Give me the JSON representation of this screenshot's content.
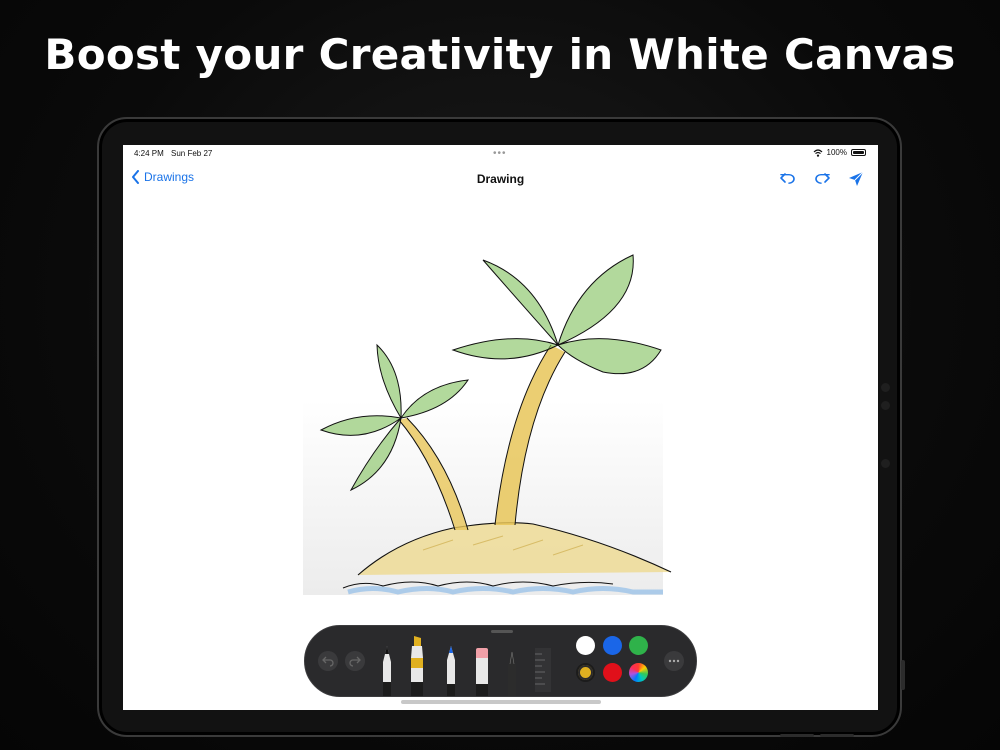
{
  "headline": "Boost your Creativity in White Canvas",
  "status_bar": {
    "time": "4:24 PM",
    "date": "Sun Feb 27",
    "battery": "100%"
  },
  "nav": {
    "back_label": "Drawings",
    "title": "Drawing"
  },
  "icons": {
    "back": "chevron-left-icon",
    "undo": "undo-icon",
    "redo": "redo-icon",
    "share": "send-icon",
    "wifi": "wifi-icon",
    "battery": "battery-icon",
    "more": "ellipsis-icon",
    "ruler": "ruler-icon"
  },
  "tools": [
    "pen",
    "marker",
    "pencil",
    "eraser",
    "lasso",
    "ruler"
  ],
  "palette": {
    "row1": [
      "#ffffff",
      "#1a66e8",
      "#2fb24a"
    ],
    "row2": [
      "#e0b020",
      "#e0101a",
      "multicolor"
    ],
    "selected": "#e0b020"
  },
  "colors": {
    "accent": "#1a73e8",
    "palm_leaf": "#7fbf5a",
    "palm_trunk": "#e8c659",
    "sand": "#eed88a",
    "water": "#9cc3e8"
  }
}
